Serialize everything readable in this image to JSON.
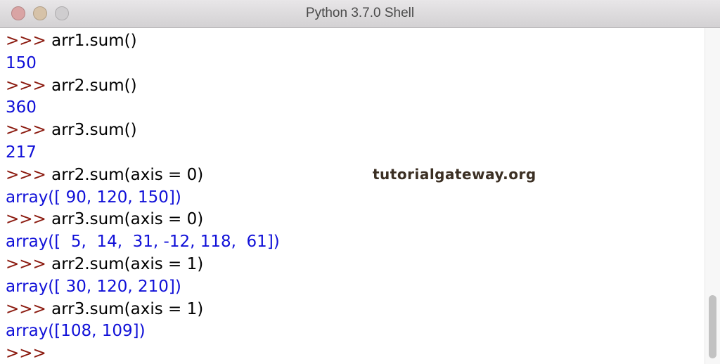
{
  "window": {
    "title": "Python 3.7.0 Shell"
  },
  "console": {
    "prompt": ">>>",
    "lines": [
      {
        "type": "input",
        "text": " arr1.sum()"
      },
      {
        "type": "output",
        "text": "150"
      },
      {
        "type": "input",
        "text": " arr2.sum()"
      },
      {
        "type": "output",
        "text": "360"
      },
      {
        "type": "input",
        "text": " arr3.sum()"
      },
      {
        "type": "output",
        "text": "217"
      },
      {
        "type": "input",
        "text": " arr2.sum(axis = 0)"
      },
      {
        "type": "output",
        "text": "array([ 90, 120, 150])"
      },
      {
        "type": "input",
        "text": " arr3.sum(axis = 0)"
      },
      {
        "type": "output",
        "text": "array([  5,  14,  31, -12, 118,  61])"
      },
      {
        "type": "input",
        "text": " arr2.sum(axis = 1)"
      },
      {
        "type": "output",
        "text": "array([ 30, 120, 210])"
      },
      {
        "type": "input",
        "text": " arr3.sum(axis = 1)"
      },
      {
        "type": "output",
        "text": "array([108, 109])"
      },
      {
        "type": "prompt-only",
        "text": ""
      }
    ]
  },
  "watermark": {
    "text": "tutorialgateway.org"
  },
  "colors": {
    "prompt": "#8b1a0f",
    "input": "#000000",
    "output": "#1010d8"
  }
}
